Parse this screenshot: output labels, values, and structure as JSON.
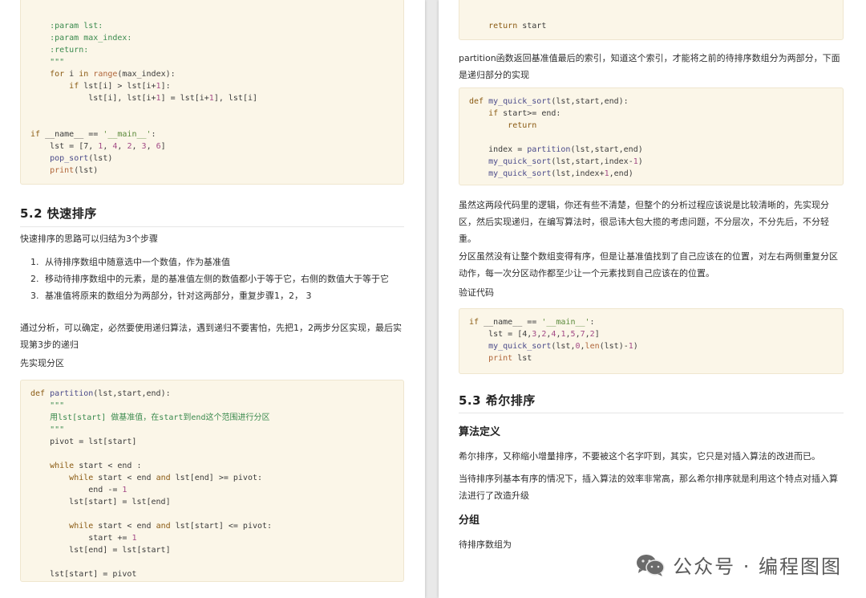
{
  "left_page": {
    "code_top": {
      "lines": [
        "    :param lst:",
        "    :param max_index:",
        "    :return:",
        "    \"\"\"",
        "    for i in range(max_index):",
        "        if lst[i] > lst[i+1]:",
        "            lst[i], lst[i+1] = lst[i+1], lst[i]",
        "",
        "",
        "if __name__ == '__main__':",
        "    lst = [7, 1, 4, 2, 3, 6]",
        "    pop_sort(lst)",
        "    print(lst)"
      ]
    },
    "section_title": "5.2 快速排序",
    "intro": "快速排序的思路可以归结为3个步骤",
    "steps": [
      {
        "num": "1.",
        "text": "从待排序数组中随意选中一个数值，作为基准值"
      },
      {
        "num": "2.",
        "text": "移动待排序数组中的元素，是的基准值左侧的数值都小于等于它，右侧的数值大于等于它"
      },
      {
        "num": "3.",
        "text": "基准值将原来的数组分为两部分，针对这两部分，重复步骤1，2， 3"
      }
    ],
    "analysis": "通过分析，可以确定，必然要使用递归算法，遇到递归不要害怕，先把1，2两步分区实现，最后实现第3步的递归",
    "partition_intro": "先实现分区",
    "code_partition": {
      "lines": [
        "def partition(lst,start,end):",
        "    \"\"\"",
        "    用lst[start] 做基准值，在start到end这个范围进行分区",
        "    \"\"\"",
        "    pivot = lst[start]",
        "",
        "    while start < end :",
        "        while start < end and lst[end] >= pivot:",
        "            end -= 1",
        "        lst[start] = lst[end]",
        "",
        "        while start < end and lst[start] <= pivot:",
        "            start += 1",
        "        lst[end] = lst[start]",
        "",
        "    lst[start] = pivot"
      ]
    }
  },
  "right_page": {
    "code_return": {
      "lines": [
        "    return start"
      ]
    },
    "partition_note": "partition函数返回基准值最后的索引，知道这个索引，才能将之前的待排序数组分为两部分，下面是递归部分的实现",
    "code_quick_sort": {
      "lines": [
        "def my_quick_sort(lst,start,end):",
        "    if start>= end:",
        "        return",
        "",
        "    index = partition(lst,start,end)",
        "    my_quick_sort(lst,start,index-1)",
        "    my_quick_sort(lst,index+1,end)"
      ]
    },
    "para_logic": "虽然这两段代码里的逻辑，你还有些不清楚，但整个的分析过程应该说是比较清晰的，先实现分区，然后实现递归，在编写算法时，很忌讳大包大揽的考虑问题，不分层次，不分先后，不分轻重。",
    "para_partition": "分区虽然没有让整个数组变得有序，但是让基准值找到了自己应该在的位置，对左右两侧重复分区动作，每一次分区动作都至少让一个元素找到自己应该在的位置。",
    "verify_label": "验证代码",
    "code_verify": {
      "lines": [
        "if __name__ == '__main__':",
        "    lst = [4,3,2,4,1,5,7,2]",
        "    my_quick_sort(lst,0,len(lst)-1)",
        "    print lst"
      ]
    },
    "section_title": "5.3 希尔排序",
    "sub_definition": "算法定义",
    "para_def": "希尔排序，又称缩小增量排序，不要被这个名字吓到，其实，它只是对插入算法的改进而已。",
    "para_improve": "当待排序列基本有序的情况下，插入算法的效率非常高，那么希尔排序就是利用这个特点对插入算法进行了改造升级",
    "sub_group": "分组",
    "para_array": "待排序数组为"
  },
  "watermark": {
    "icon": "wechat-icon",
    "text": "公众号 · 编程图图"
  }
}
